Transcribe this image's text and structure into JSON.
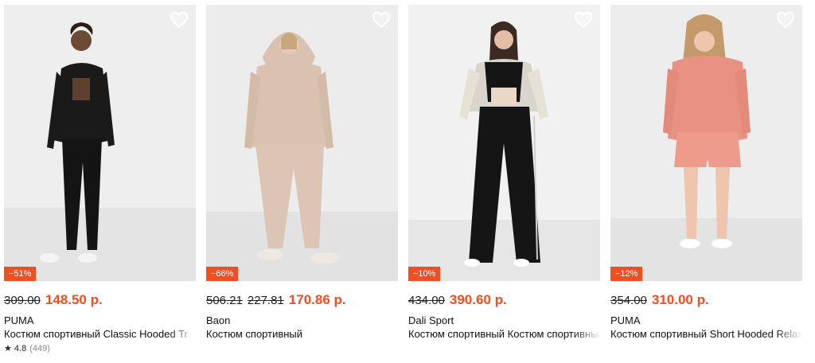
{
  "products": [
    {
      "brand": "PUMA",
      "title": "Костюм спортивный Classic Hooded Tr",
      "discount": "−51%",
      "old_prices": [
        "309.00"
      ],
      "price": "148.50 р.",
      "rating": "★ 4.8",
      "reviews": "(449)",
      "outfit_color": "#1a1a1a",
      "bg_color": "#eeeeee"
    },
    {
      "brand": "Baon",
      "title": "Костюм спортивный",
      "discount": "−66%",
      "old_prices": [
        "506.21",
        "227.81"
      ],
      "price": "170.86 р.",
      "outfit_color": "#d9c2b0",
      "bg_color": "#ececec"
    },
    {
      "brand": "Dali Sport",
      "title": "Костюм спортивный Костюм спортивный",
      "discount": "−10%",
      "old_prices": [
        "434.00"
      ],
      "price": "390.60 р.",
      "outfit_color": "#151515",
      "bg_color": "#f1f1f1"
    },
    {
      "brand": "PUMA",
      "title": "Костюм спортивный Short Hooded Relax",
      "discount": "−12%",
      "old_prices": [
        "354.00"
      ],
      "price": "310.00 р.",
      "outfit_color": "#e99283",
      "bg_color": "#ededed"
    }
  ],
  "colors": {
    "accent": "#f04e23",
    "text": "#111111"
  },
  "icons": {
    "favorite": "heart-outline-icon"
  }
}
